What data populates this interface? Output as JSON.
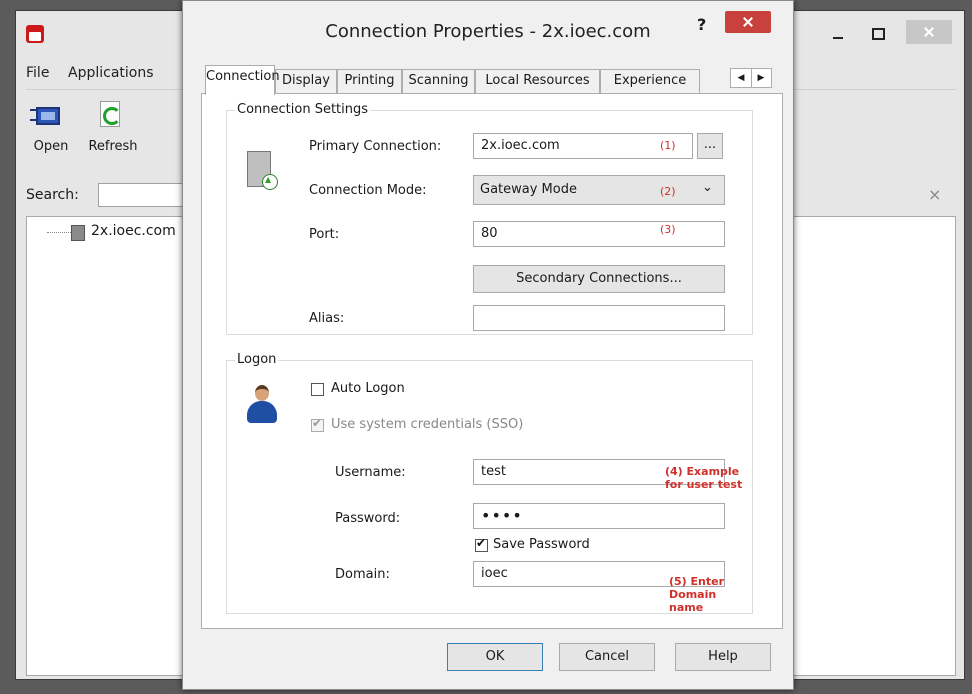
{
  "main_window": {
    "menu": [
      "File",
      "Applications"
    ],
    "toolbar": {
      "open_label": "Open",
      "refresh_label": "Refresh"
    },
    "search_label": "Search:",
    "search_clear": "×",
    "tree_item": "2x.ioec.com"
  },
  "dialog": {
    "title": "Connection Properties - 2x.ioec.com",
    "help_glyph": "?",
    "tabs": [
      "Connection",
      "Display",
      "Printing",
      "Scanning",
      "Local Resources",
      "Experience"
    ],
    "active_tab": "Connection",
    "scroll_left": "◀",
    "scroll_right": "▶",
    "connection_settings": {
      "group_title": "Connection Settings",
      "primary_label": "Primary Connection:",
      "primary_value": "2x.ioec.com",
      "primary_annot": "(1)",
      "browse_label": "...",
      "mode_label": "Connection Mode:",
      "mode_value": "Gateway Mode",
      "mode_annot": "(2)",
      "mode_arrow": "⌄",
      "port_label": "Port:",
      "port_value": "80",
      "port_annot": "(3)",
      "secondary_button": "Secondary Connections...",
      "alias_label": "Alias:",
      "alias_value": ""
    },
    "logon": {
      "group_title": "Logon",
      "auto_logon": "Auto Logon",
      "auto_logon_checked": false,
      "sso_label": "Use system credentials (SSO)",
      "sso_checked": true,
      "username_label": "Username:",
      "username_value": "test",
      "username_annot": "(4) Example for user test",
      "password_label": "Password:",
      "password_value": "••••",
      "save_password": "Save Password",
      "save_password_checked": true,
      "domain_label": "Domain:",
      "domain_value": "ioec",
      "domain_annot": "(5) Enter Domain name"
    },
    "buttons": {
      "ok": "OK",
      "cancel": "Cancel",
      "help": "Help"
    }
  },
  "colors": {
    "annotation": "#d0302a",
    "close_button": "#c9413c",
    "backdrop": "#5b5b5b"
  }
}
